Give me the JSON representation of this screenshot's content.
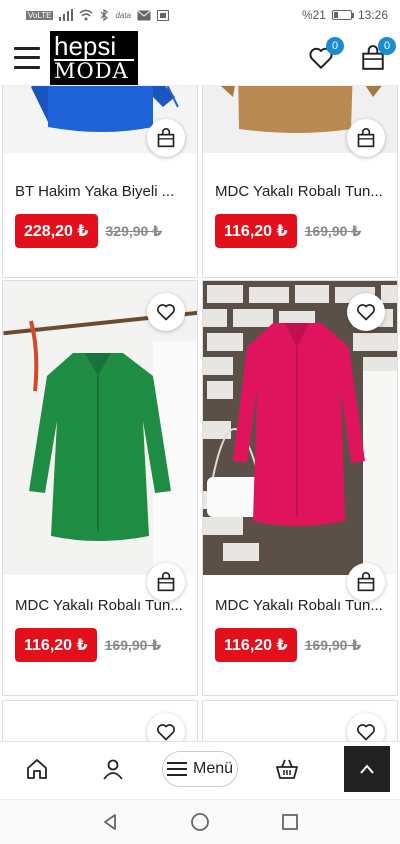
{
  "status_bar": {
    "left_icons": [
      "VoLTE",
      "signal-icon",
      "wifi-icon",
      "bluetooth-icon",
      "data-icon",
      "mail-icon",
      "gallery-icon"
    ],
    "battery": "%21",
    "time": "13:26"
  },
  "header": {
    "logo_line1": "hepsi",
    "logo_line2": "MODA",
    "wishlist_count": "0",
    "cart_count": "0"
  },
  "products": [
    {
      "title": "BT Hakim Yaka Biyeli ...",
      "price": "228,20 ₺",
      "old_price": "329,90 ₺",
      "image_color": "#1e63d8"
    },
    {
      "title": "MDC Yakalı Robalı Tun...",
      "price": "116,20 ₺",
      "old_price": "169,90 ₺",
      "image_color": "#b88a52"
    },
    {
      "title": "MDC Yakalı Robalı Tun...",
      "price": "116,20 ₺",
      "old_price": "169,90 ₺",
      "image_color": "#1f8c43"
    },
    {
      "title": "MDC Yakalı Robalı Tun...",
      "price": "116,20 ₺",
      "old_price": "169,90 ₺",
      "image_color": "#e0135d"
    }
  ],
  "bottom_nav": {
    "menu_label": "Menü"
  },
  "colors": {
    "price_bg": "#e3101b",
    "badge": "#1a8bd6"
  }
}
